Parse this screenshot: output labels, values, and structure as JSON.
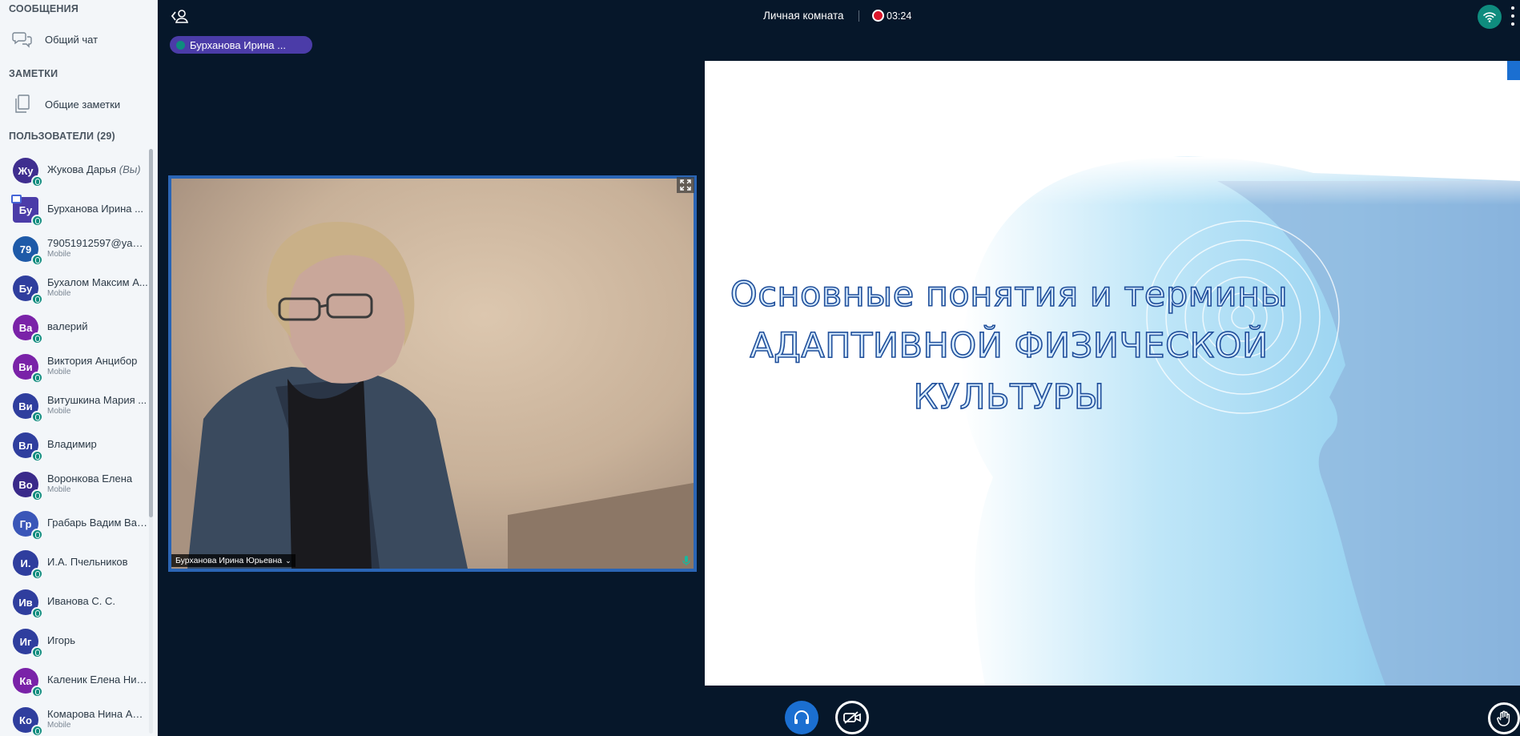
{
  "sidebar": {
    "messages_title": "СООБЩЕНИЯ",
    "public_chat": "Общий чат",
    "notes_title": "ЗАМЕТКИ",
    "shared_notes": "Общие заметки",
    "users_title": "ПОЛЬЗОВАТЕЛИ (29)",
    "users": [
      {
        "initials": "Жу",
        "name": "Жукова Дарья",
        "you": "(Вы)",
        "sub": "",
        "color": "#3f2e8f"
      },
      {
        "initials": "Бу",
        "name": "Бурханова Ирина ...",
        "you": "",
        "sub": "",
        "color": "#4b3ca8"
      },
      {
        "initials": "79",
        "name": "79051912597@yande...",
        "you": "",
        "sub": "Mobile",
        "color": "#1e5aa8"
      },
      {
        "initials": "Бу",
        "name": "Бухалом Максим А...",
        "you": "",
        "sub": "Mobile",
        "color": "#2f3e9e"
      },
      {
        "initials": "Ва",
        "name": "валерий",
        "you": "",
        "sub": "",
        "color": "#7a22a8"
      },
      {
        "initials": "Ви",
        "name": "Виктория Анцибор",
        "you": "",
        "sub": "Mobile",
        "color": "#7a22a8"
      },
      {
        "initials": "Ви",
        "name": "Витушкина Мария ...",
        "you": "",
        "sub": "Mobile",
        "color": "#2f3e9e"
      },
      {
        "initials": "Вл",
        "name": "Владимир",
        "you": "",
        "sub": "",
        "color": "#2f3e9e"
      },
      {
        "initials": "Во",
        "name": "Воронкова Елена",
        "you": "",
        "sub": "Mobile",
        "color": "#3a2a8a"
      },
      {
        "initials": "Гр",
        "name": "Грабарь Вадим Вал...",
        "you": "",
        "sub": "",
        "color": "#3a56b8"
      },
      {
        "initials": "И.",
        "name": "И.А. Пчельников",
        "you": "",
        "sub": "",
        "color": "#2f3e9e"
      },
      {
        "initials": "Ив",
        "name": "Иванова С. С.",
        "you": "",
        "sub": "",
        "color": "#2f3e9e"
      },
      {
        "initials": "Иг",
        "name": "Игорь",
        "you": "",
        "sub": "",
        "color": "#2f3e9e"
      },
      {
        "initials": "Ка",
        "name": "Каленик Елена Ник...",
        "you": "",
        "sub": "",
        "color": "#7a22a8"
      },
      {
        "initials": "Ко",
        "name": "Комарова Нина Ана...",
        "you": "",
        "sub": "Mobile",
        "color": "#2f3e9e"
      }
    ]
  },
  "header": {
    "room_title": "Личная комната",
    "rec_time": "03:24"
  },
  "talker": "Бурханова Ирина ...",
  "webcam": {
    "label": "Бурханова Ирина Юрьевна",
    "caret": "⌄"
  },
  "slide": {
    "lines": [
      "Основные понятия и термины",
      "АДАПТИВНОЙ ФИЗИЧЕСКОЙ",
      "КУЛЬТУРЫ"
    ]
  },
  "icons": {
    "back": "chevron-left-user-icon",
    "connection": "wifi-icon",
    "audio": "headphones-icon",
    "video": "camera-off-icon",
    "hand": "hand-icon"
  },
  "colors": {
    "accent": "#1b6fd1",
    "talker": "#4b3ca8",
    "mic": "#0f8c7e",
    "record": "#d9162a"
  }
}
